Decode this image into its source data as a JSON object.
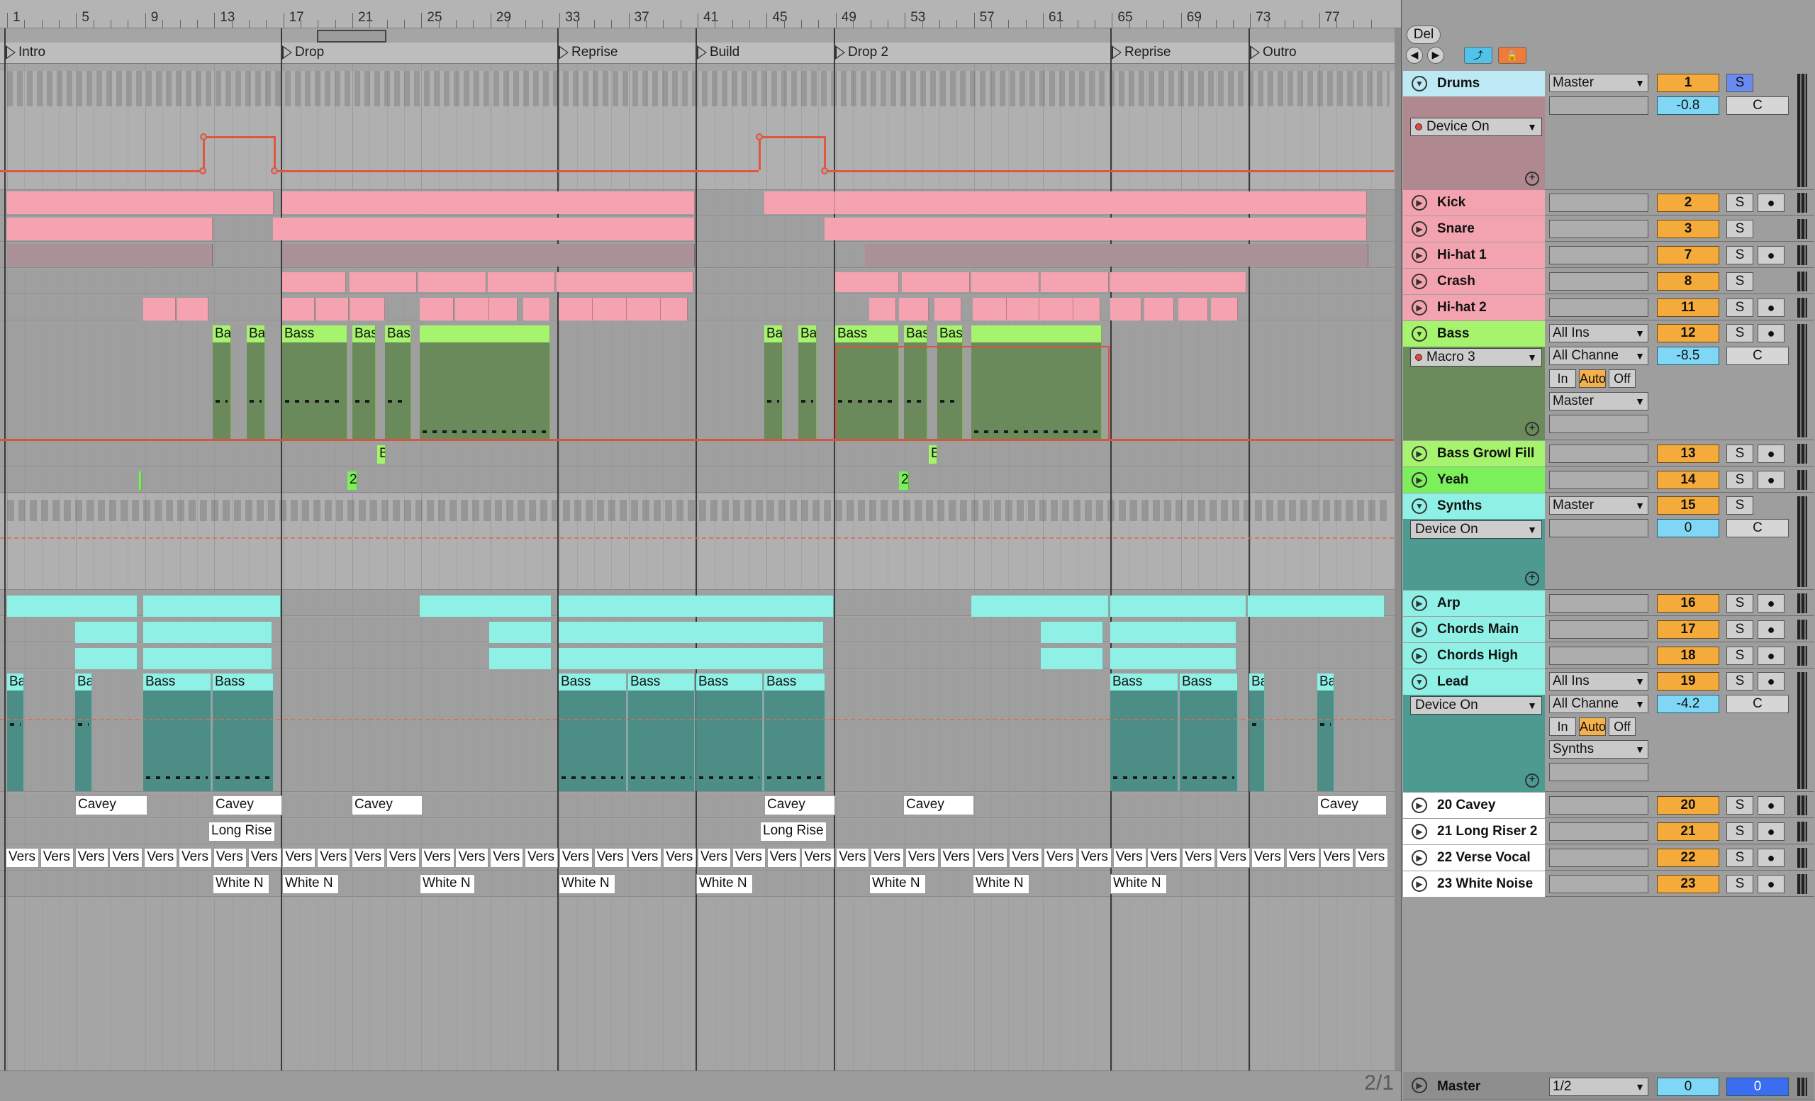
{
  "ruler": {
    "bars": [
      "1",
      "5",
      "9",
      "13",
      "17",
      "21",
      "25",
      "29",
      "33",
      "37",
      "41",
      "45",
      "49",
      "53",
      "57",
      "61",
      "65",
      "69",
      "73",
      "77"
    ]
  },
  "locators": [
    "Intro",
    "Drop",
    "Reprise",
    "Build",
    "Drop 2",
    "Reprise",
    "Outro"
  ],
  "clips": {
    "bass_ab": "Ba",
    "bass": "Bass",
    "bass_as": "Bas",
    "bass_b": "B",
    "yeah_label": "2",
    "cavey": "Cavey",
    "long_rise": "Long Rise",
    "vers": "Vers",
    "white_n": "White N"
  },
  "page_indicator": "2/1",
  "toolbar": {
    "del_label": "Del",
    "back_icon": "circle-left-icon",
    "fwd_icon": "circle-right-icon",
    "follow_icon": "follow-icon",
    "lock_icon": "lock-icon"
  },
  "tracks": [
    {
      "name": "Drums",
      "color": "#bde9f5",
      "io1": "Master",
      "num": "1",
      "solo": "S",
      "vol": "-0.8",
      "pan": "C",
      "device": "Device On",
      "kind": "group"
    },
    {
      "name": "Kick",
      "color": "#f3a3b0",
      "num": "2",
      "solo": "S"
    },
    {
      "name": "Snare",
      "color": "#f3a3b0",
      "num": "3",
      "solo": "S"
    },
    {
      "name": "Hi-hat 1",
      "color": "#f3a3b0",
      "num": "7",
      "solo": "S"
    },
    {
      "name": "Crash",
      "color": "#f3a3b0",
      "num": "8",
      "solo": "S"
    },
    {
      "name": "Hi-hat 2",
      "color": "#f3a3b0",
      "num": "11",
      "solo": "S"
    },
    {
      "name": "Bass",
      "color": "#a6f36d",
      "io1": "All Ins",
      "io2": "All Channe",
      "io_mon_in": "In",
      "io_mon_auto": "Auto",
      "io_mon_off": "Off",
      "io3": "Master",
      "num": "12",
      "solo": "S",
      "vol": "-8.5",
      "pan": "C",
      "device": "Macro 3"
    },
    {
      "name": "Bass Growl Fill",
      "color": "#a6f36d",
      "num": "13",
      "solo": "S"
    },
    {
      "name": "Yeah",
      "color": "#7cf05a",
      "num": "14",
      "solo": "S"
    },
    {
      "name": "Synths",
      "color": "#8ff0e6",
      "io1": "Master",
      "num": "15",
      "solo": "S",
      "vol": "0",
      "pan": "C",
      "device": "Device On"
    },
    {
      "name": "Arp",
      "color": "#8ff0e6",
      "num": "16",
      "solo": "S"
    },
    {
      "name": "Chords Main",
      "color": "#8ff0e6",
      "num": "17",
      "solo": "S"
    },
    {
      "name": "Chords High",
      "color": "#8ff0e6",
      "num": "18",
      "solo": "S"
    },
    {
      "name": "Lead",
      "color": "#8ff0e6",
      "io1": "All Ins",
      "io2": "All Channe",
      "io_mon_in": "In",
      "io_mon_auto": "Auto",
      "io_mon_off": "Off",
      "io3": "Synths",
      "num": "19",
      "solo": "S",
      "vol": "-4.2",
      "pan": "C",
      "device": "Device On"
    },
    {
      "name": "20 Cavey",
      "color": "#ffffff",
      "num": "20",
      "solo": "S"
    },
    {
      "name": "21 Long Riser 2",
      "color": "#ffffff",
      "num": "21",
      "solo": "S"
    },
    {
      "name": "22 Verse Vocal",
      "color": "#ffffff",
      "num": "22",
      "solo": "S"
    },
    {
      "name": "23 White Noise",
      "color": "#ffffff",
      "num": "23",
      "solo": "S"
    }
  ],
  "master": {
    "name": "Master",
    "io": "1/2",
    "num": "0",
    "vol": "0"
  }
}
